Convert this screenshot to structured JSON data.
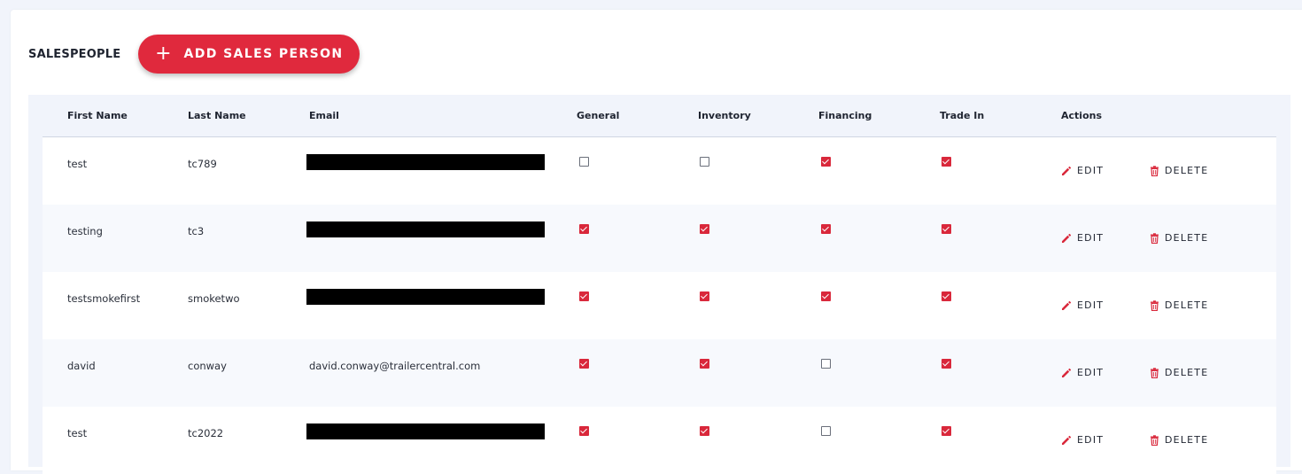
{
  "header": {
    "title": "SALESPEOPLE",
    "add_button_icon": "plus-icon",
    "add_button_label": "ADD SALES PERSON"
  },
  "colors": {
    "accent": "#e0293d",
    "checkbox_checked": "#d9283b",
    "page_background": "#f1f4fb"
  },
  "table": {
    "columns": [
      "First Name",
      "Last Name",
      "Email",
      "General",
      "Inventory",
      "Financing",
      "Trade In",
      "Actions"
    ],
    "edit_label": "EDIT",
    "delete_label": "DELETE",
    "edit_icon": "pencil-icon",
    "delete_icon": "trash-icon",
    "rows": [
      {
        "first_name": "test",
        "last_name": "tc789",
        "email": "",
        "email_redacted": true,
        "general": false,
        "inventory": false,
        "financing": true,
        "trade_in": true
      },
      {
        "first_name": "testing",
        "last_name": "tc3",
        "email": "",
        "email_redacted": true,
        "general": true,
        "inventory": true,
        "financing": true,
        "trade_in": true
      },
      {
        "first_name": "testsmokefirst",
        "last_name": "smoketwo",
        "email": "",
        "email_redacted": true,
        "general": true,
        "inventory": true,
        "financing": true,
        "trade_in": true
      },
      {
        "first_name": "david",
        "last_name": "conway",
        "email": "david.conway@trailercentral.com",
        "email_redacted": false,
        "general": true,
        "inventory": true,
        "financing": false,
        "trade_in": true
      },
      {
        "first_name": "test",
        "last_name": "tc2022",
        "email": "",
        "email_redacted": true,
        "general": true,
        "inventory": true,
        "financing": false,
        "trade_in": true
      }
    ]
  }
}
